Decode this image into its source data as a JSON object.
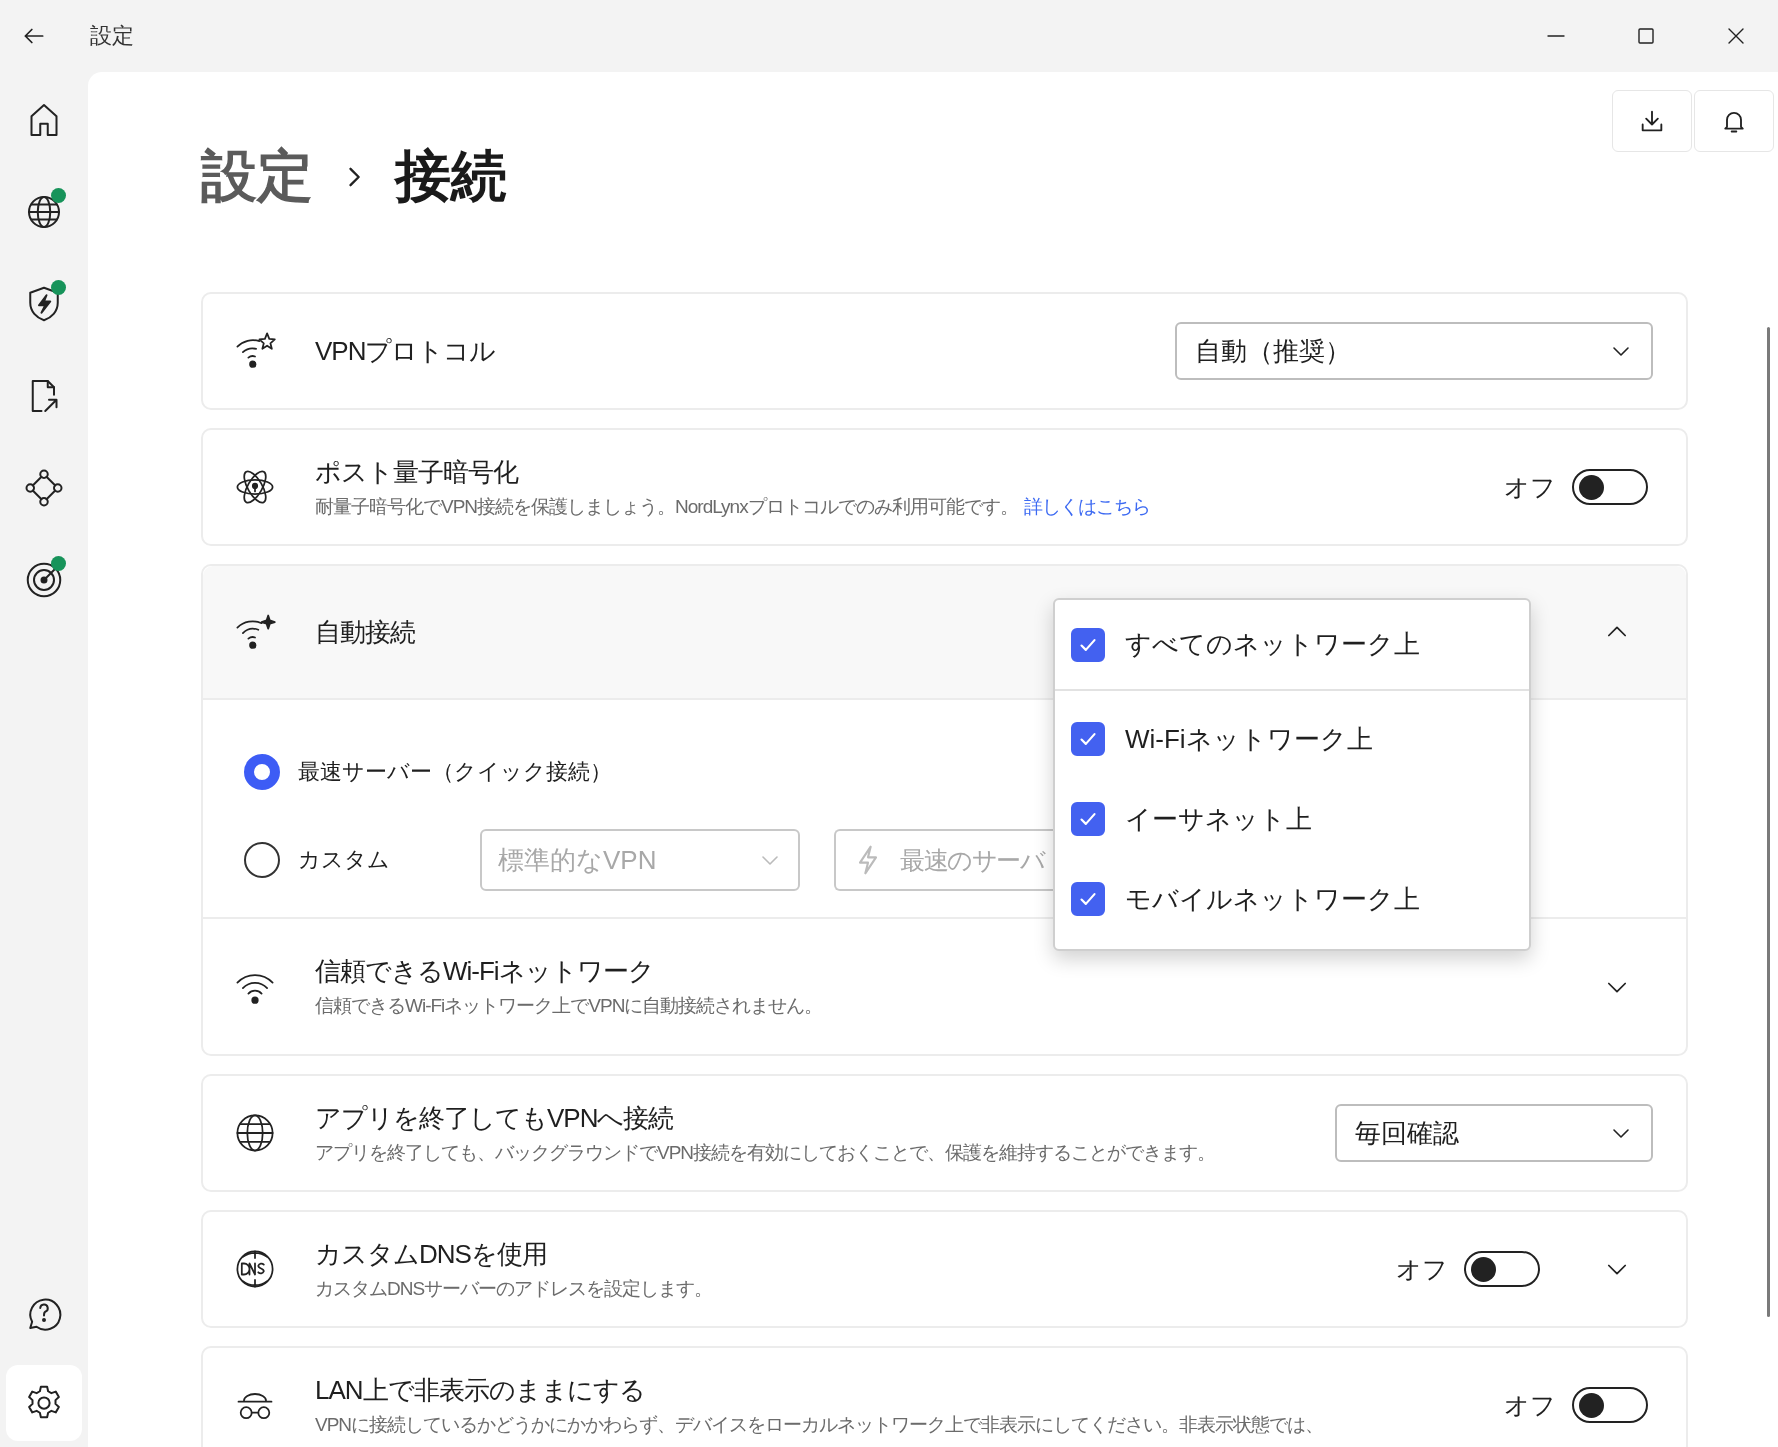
{
  "window": {
    "title": "設定"
  },
  "sidebar": {
    "items": [
      {
        "selected": false,
        "badge": false
      },
      {
        "selected": false,
        "badge": true
      },
      {
        "selected": false,
        "badge": true
      },
      {
        "selected": false,
        "badge": false
      },
      {
        "selected": false,
        "badge": false
      },
      {
        "selected": false,
        "badge": true
      }
    ],
    "bottom_items": [
      {
        "selected": false,
        "badge": false
      },
      {
        "selected": true,
        "badge": false
      }
    ]
  },
  "breadcrumb": [
    "設定",
    "接続"
  ],
  "sections": [
    {
      "kind": "select",
      "title": "VPNプロトコル",
      "value": "自動（推奨）"
    },
    {
      "kind": "toggle",
      "title": "ポスト量子暗号化",
      "description": "耐量子暗号化でVPN接続を保護しましょう。NordLynxプロトコルでのみ利用可能です。",
      "link": "詳しくはこちら",
      "state_label": "オフ",
      "on": false
    },
    {
      "kind": "autoconnect",
      "title": "自動接続",
      "expanded": true,
      "options": [
        {
          "label": "最速サーバー（クイック接続）",
          "selected": true
        },
        {
          "label": "カスタム",
          "selected": false
        }
      ],
      "type_placeholder": "標準的なVPN",
      "server_placeholder": "最速のサーバ",
      "popup": [
        {
          "label": "すべてのネットワーク上",
          "checked": true
        },
        {
          "label": "Wi-Fiネットワーク上",
          "checked": true
        },
        {
          "label": "イーサネット上",
          "checked": true
        },
        {
          "label": "モバイルネットワーク上",
          "checked": true
        }
      ],
      "trusted": {
        "title": "信頼できるWi-Fiネットワーク",
        "description": "信頼できるWi-Fiネットワーク上でVPNに自動接続されません。",
        "expanded": false
      }
    },
    {
      "kind": "select",
      "title": "アプリを終了してもVPNへ接続",
      "description": "アプリを終了しても、バックグラウンドでVPN接続を有効にしておくことで、保護を維持することができます。",
      "value": "毎回確認"
    },
    {
      "kind": "toggle",
      "title": "カスタムDNSを使用",
      "description": "カスタムDNSサーバーのアドレスを設定します。",
      "state_label": "オフ",
      "on": false,
      "expanded": false
    },
    {
      "kind": "toggle",
      "title": "LAN上で非表示のままにする",
      "description": "VPNに接続しているかどうかにかかわらず、デバイスをローカルネットワーク上で非表示にしてください。非表示状態では、",
      "state_label": "オフ",
      "on": false
    }
  ]
}
